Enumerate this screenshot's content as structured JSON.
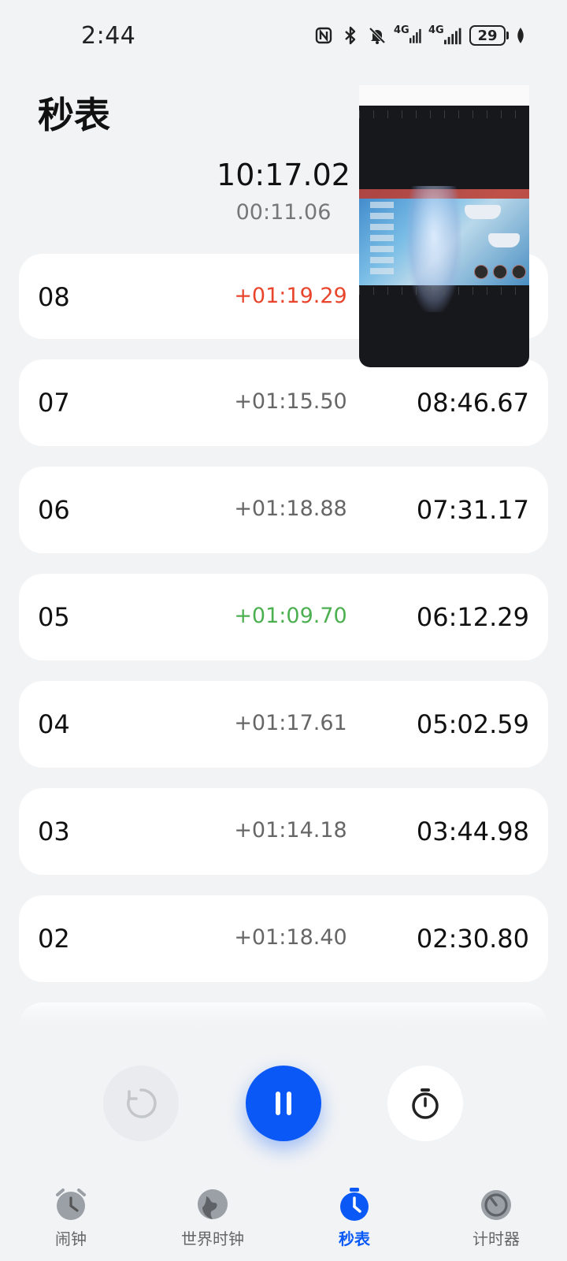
{
  "status_bar": {
    "time": "2:44",
    "network_1": "4G",
    "network_2": "4G",
    "battery": "29",
    "icons": [
      "nfc-icon",
      "bluetooth-icon",
      "mute-bell-icon",
      "signal-icon",
      "signal-icon",
      "battery-icon",
      "leaf-icon"
    ]
  },
  "page": {
    "title": "秒表"
  },
  "stopwatch": {
    "main_time": "10:17.02",
    "current_lap_time": "00:11.06"
  },
  "laps": [
    {
      "number": "08",
      "diff": "+01:19.29",
      "total": "",
      "status": "slowest"
    },
    {
      "number": "07",
      "diff": "+01:15.50",
      "total": "08:46.67",
      "status": "normal"
    },
    {
      "number": "06",
      "diff": "+01:18.88",
      "total": "07:31.17",
      "status": "normal"
    },
    {
      "number": "05",
      "diff": "+01:09.70",
      "total": "06:12.29",
      "status": "fastest"
    },
    {
      "number": "04",
      "diff": "+01:17.61",
      "total": "05:02.59",
      "status": "normal"
    },
    {
      "number": "03",
      "diff": "+01:14.18",
      "total": "03:44.98",
      "status": "normal"
    },
    {
      "number": "02",
      "diff": "+01:18.40",
      "total": "02:30.80",
      "status": "normal"
    }
  ],
  "colors": {
    "accent": "#0a59f7",
    "slowest": "#e8452c",
    "fastest": "#4caf50",
    "background": "#f1f3f5"
  },
  "controls": {
    "reset_icon": "reset-icon",
    "pause_icon": "pause-icon",
    "lap_icon": "stopwatch-icon"
  },
  "tabs": [
    {
      "label": "闹钟",
      "icon": "alarm-clock-icon",
      "active": false
    },
    {
      "label": "世界时钟",
      "icon": "globe-icon",
      "active": false
    },
    {
      "label": "秒表",
      "icon": "stopwatch-icon",
      "active": true
    },
    {
      "label": "计时器",
      "icon": "timer-icon",
      "active": false
    }
  ]
}
